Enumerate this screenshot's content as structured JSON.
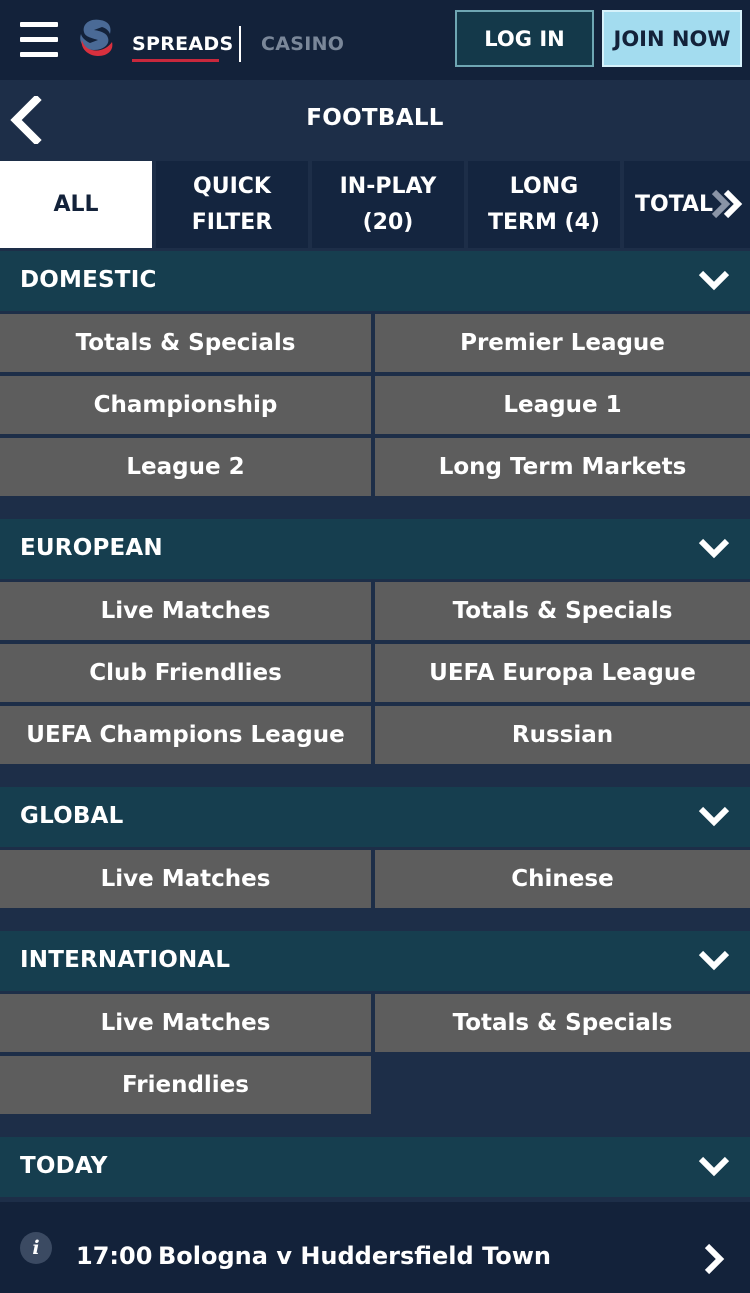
{
  "header": {
    "nav": {
      "spreads": "SPREADS",
      "casino": "CASINO"
    },
    "login_label": "LOG IN",
    "join_label": "JOIN NOW"
  },
  "title": "FOOTBALL",
  "tabs": [
    {
      "label": "ALL",
      "active": true
    },
    {
      "label": "QUICK FILTER"
    },
    {
      "label": "IN-PLAY (20)"
    },
    {
      "label": "LONG TERM (4)"
    },
    {
      "label": "TOTAL"
    }
  ],
  "sections": [
    {
      "title": "DOMESTIC",
      "items": [
        "Totals & Specials",
        "Premier League",
        "Championship",
        "League 1",
        "League 2",
        "Long Term Markets"
      ]
    },
    {
      "title": "EUROPEAN",
      "items": [
        "Live Matches",
        "Totals & Specials",
        "Club Friendlies",
        "UEFA Europa League",
        "UEFA Champions League",
        "Russian"
      ]
    },
    {
      "title": "GLOBAL",
      "items": [
        "Live Matches",
        "Chinese"
      ]
    },
    {
      "title": "INTERNATIONAL",
      "items": [
        "Live Matches",
        "Totals & Specials",
        "Friendlies"
      ]
    },
    {
      "title": "TODAY"
    }
  ],
  "match": {
    "time": "17:00",
    "name": "Bologna v Huddersfield Town"
  },
  "icons": {
    "menu": "hamburger-icon",
    "logo": "spreads-logo-icon",
    "back": "chevron-left-icon",
    "expand": "chevron-down-icon",
    "more": "double-chevron-right-icon",
    "info": "info-icon",
    "open": "chevron-right-icon"
  },
  "colors": {
    "background": "#1d2e48",
    "topbar": "#13223a",
    "section_header": "#163e4f",
    "cell": "#5d5d5d",
    "join_button": "#a3dcef",
    "login_border": "#6fa6b3",
    "spreads_underline": "#c8283c",
    "casino_text": "#7a8799"
  }
}
